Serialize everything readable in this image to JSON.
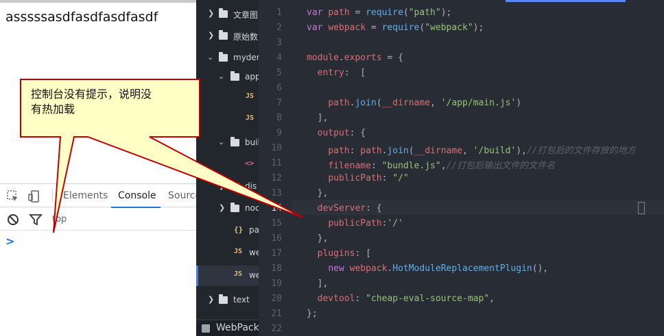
{
  "browser": {
    "page_text": "asssssasdfasdfasdfasdf",
    "devtools": {
      "tabs": [
        "Elements",
        "Console",
        "Sources"
      ],
      "active_tab": "Console",
      "filter_text": "top",
      "prompt": ">"
    }
  },
  "file_tree": {
    "items": [
      {
        "label": "文章图",
        "type": "folder",
        "expanded": false
      },
      {
        "label": "原始数",
        "type": "folder",
        "expanded": false
      },
      {
        "label": "mydem",
        "type": "folder",
        "expanded": true
      },
      {
        "label": "app",
        "type": "folder",
        "expanded": true
      },
      {
        "label": "",
        "type": "js"
      },
      {
        "label": "",
        "type": "js"
      },
      {
        "label": "buil",
        "type": "folder",
        "expanded": true
      },
      {
        "label": "",
        "type": "html"
      },
      {
        "label": "dis",
        "type": "folder",
        "expanded": false
      },
      {
        "label": "noc",
        "type": "folder",
        "expanded": false
      },
      {
        "label": "pa",
        "type": "json"
      },
      {
        "label": "we",
        "type": "js"
      },
      {
        "label": "we",
        "type": "js",
        "selected": true
      },
      {
        "label": "text",
        "type": "folder",
        "expanded": false
      }
    ],
    "bottom_label": "WebPack"
  },
  "editor": {
    "active_line": 14,
    "line_numbers": [
      "1",
      "2",
      "3",
      "4",
      "5",
      "6",
      "7",
      "8",
      "9",
      "10",
      "11",
      "12",
      "13",
      "14",
      "15",
      "16",
      "17",
      "18",
      "19",
      "20",
      "21",
      "22"
    ]
  },
  "callout": {
    "line1": "控制台没有提示，说明没",
    "line2": "有热加载"
  },
  "colors": {
    "editor_bg": "#282c34",
    "tree_bg": "#22262d",
    "callout_fill": "#ffffc6",
    "callout_border": "#c00000",
    "keyword": "#c678dd",
    "string": "#98c379",
    "function": "#61afef"
  }
}
